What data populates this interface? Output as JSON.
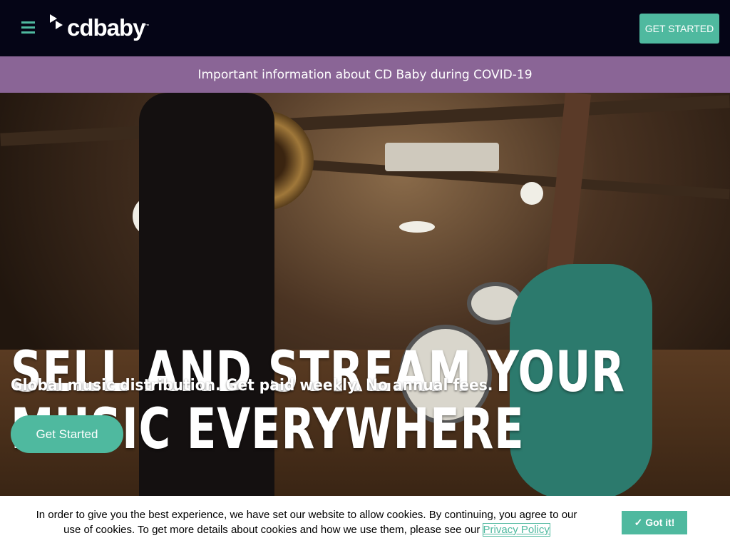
{
  "header": {
    "logo_text": "cdbaby",
    "get_started": "GET STARTED"
  },
  "banner": {
    "text": "Important information about CD Baby during COVID-19"
  },
  "hero": {
    "headline_line1": "SELL AND STREAM YOUR",
    "headline_line2": "MUSIC EVERYWHERE",
    "subheadline": "Global music distribution. Get paid weekly. No annual fees.",
    "cta": "Get Started"
  },
  "cookie": {
    "text": "In order to give you the best experience, we have set our website to allow cookies. By continuing, you agree to our use of cookies. To get more details about cookies and how we use them, please see our",
    "link": "Privacy Policy",
    "button": "✓ Got it!"
  },
  "colors": {
    "accent": "#4fb99f",
    "banner": "#8a6596",
    "nav": "#050516"
  }
}
